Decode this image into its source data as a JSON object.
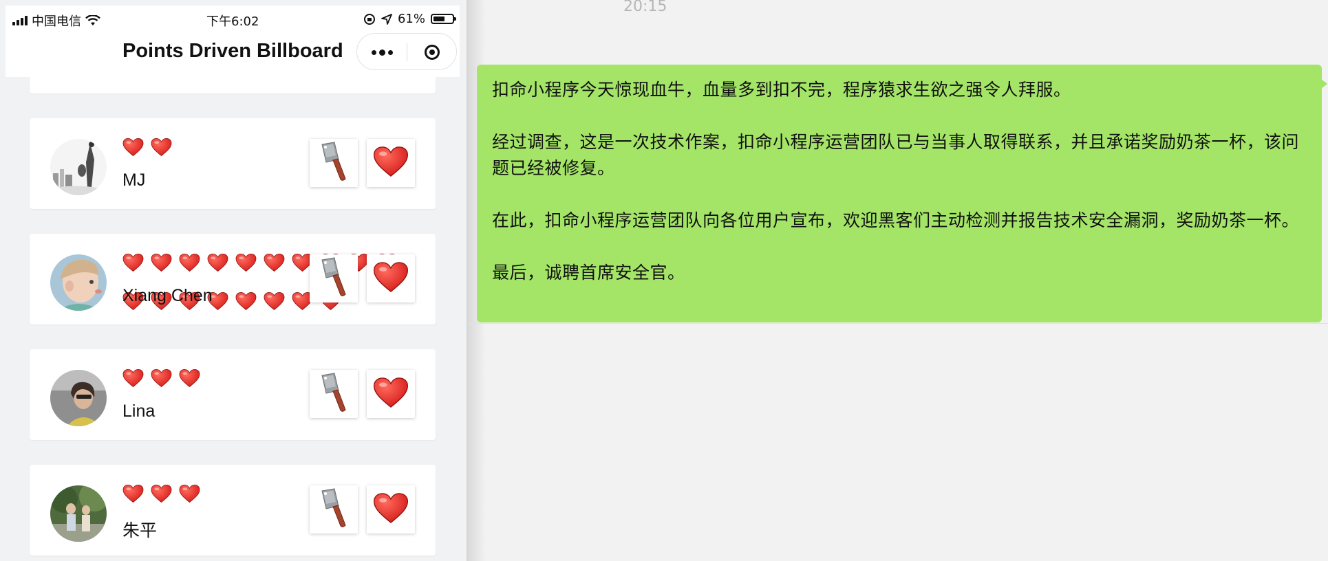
{
  "status_bar": {
    "carrier": "中国电信",
    "time": "下午6:02",
    "battery": "61%",
    "battery_level": 0.61
  },
  "nav": {
    "title": "Points Driven Billboard"
  },
  "cards": [
    {
      "name": "MJ",
      "hearts": 2
    },
    {
      "name": "Xiang Chen",
      "hearts": 18
    },
    {
      "name": "Lina",
      "hearts": 3
    },
    {
      "name": "朱平",
      "hearts": 3
    }
  ],
  "colors": {
    "bubble": "#a4e567",
    "heart": "#d8211e",
    "background": "#f1f2f4"
  },
  "icons": {
    "cleaver": "cleaver-icon",
    "love": "heart-icon"
  },
  "chat": {
    "time": "20:15",
    "paragraphs": [
      "扣命小程序今天惊现血牛，血量多到扣不完，程序猿求生欲之强令人拜服。",
      "经过调查，这是一次技术作案，扣命小程序运营团队已与当事人取得联系，并且承诺奖励奶茶一杯，该问题已经被修复。",
      "在此，扣命小程序运营团队向各位用户宣布，欢迎黑客们主动检测并报告技术安全漏洞，奖励奶茶一杯。",
      "最后，诚聘首席安全官。"
    ]
  }
}
